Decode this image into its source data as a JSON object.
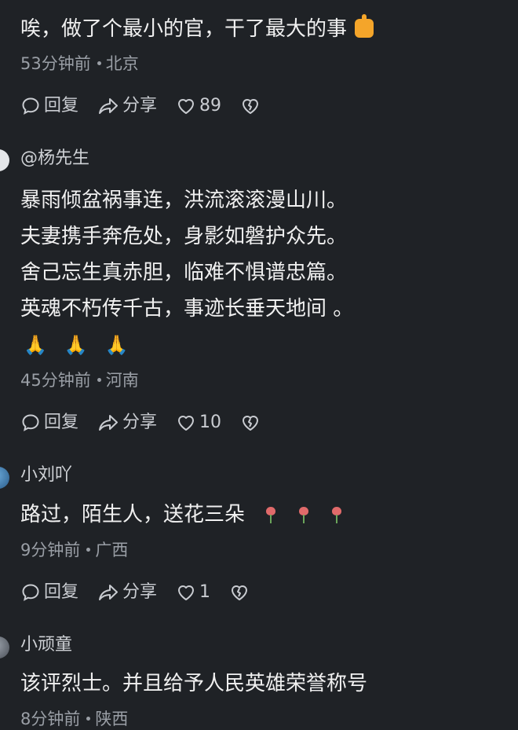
{
  "comments": [
    {
      "username": "",
      "lines": [
        "唉，做了个最小的官，干了最大的事"
      ],
      "emoji": "thumbs-up",
      "time": "53分钟前",
      "location": "北京",
      "reply_label": "回复",
      "share_label": "分享",
      "likes": "89"
    },
    {
      "username": "@杨先生",
      "lines": [
        "暴雨倾盆祸事连，洪流滚滚漫山川。",
        "夫妻携手奔危处，身影如磐护众先。",
        "舍己忘生真赤胆，临难不惧谱忠篇。",
        "英魂不朽传千古，事迹长垂天地间 。"
      ],
      "emoji_row": [
        "🙏",
        "🙏",
        "🙏"
      ],
      "time": "45分钟前",
      "location": "河南",
      "reply_label": "回复",
      "share_label": "分享",
      "likes": "10"
    },
    {
      "username": "小刘吖",
      "lines": [
        "路过，陌生人，送花三朵"
      ],
      "emoji": "flowers",
      "time": "9分钟前",
      "location": "广西",
      "reply_label": "回复",
      "share_label": "分享",
      "likes": "1"
    },
    {
      "username": "小顽童",
      "lines": [
        "该评烈士。并且给予人民英雄荣誉称号"
      ],
      "time": "8分钟前",
      "location": "陕西"
    }
  ],
  "icons": {
    "reply": "comment-bubble-icon",
    "share": "share-arrow-icon",
    "like": "heart-icon",
    "dislike": "broken-heart-icon"
  },
  "colors": {
    "background": "#1f2226",
    "text": "#f0f0f0",
    "meta": "#9a9fa6",
    "emoji_gold": "#f4a52a"
  }
}
